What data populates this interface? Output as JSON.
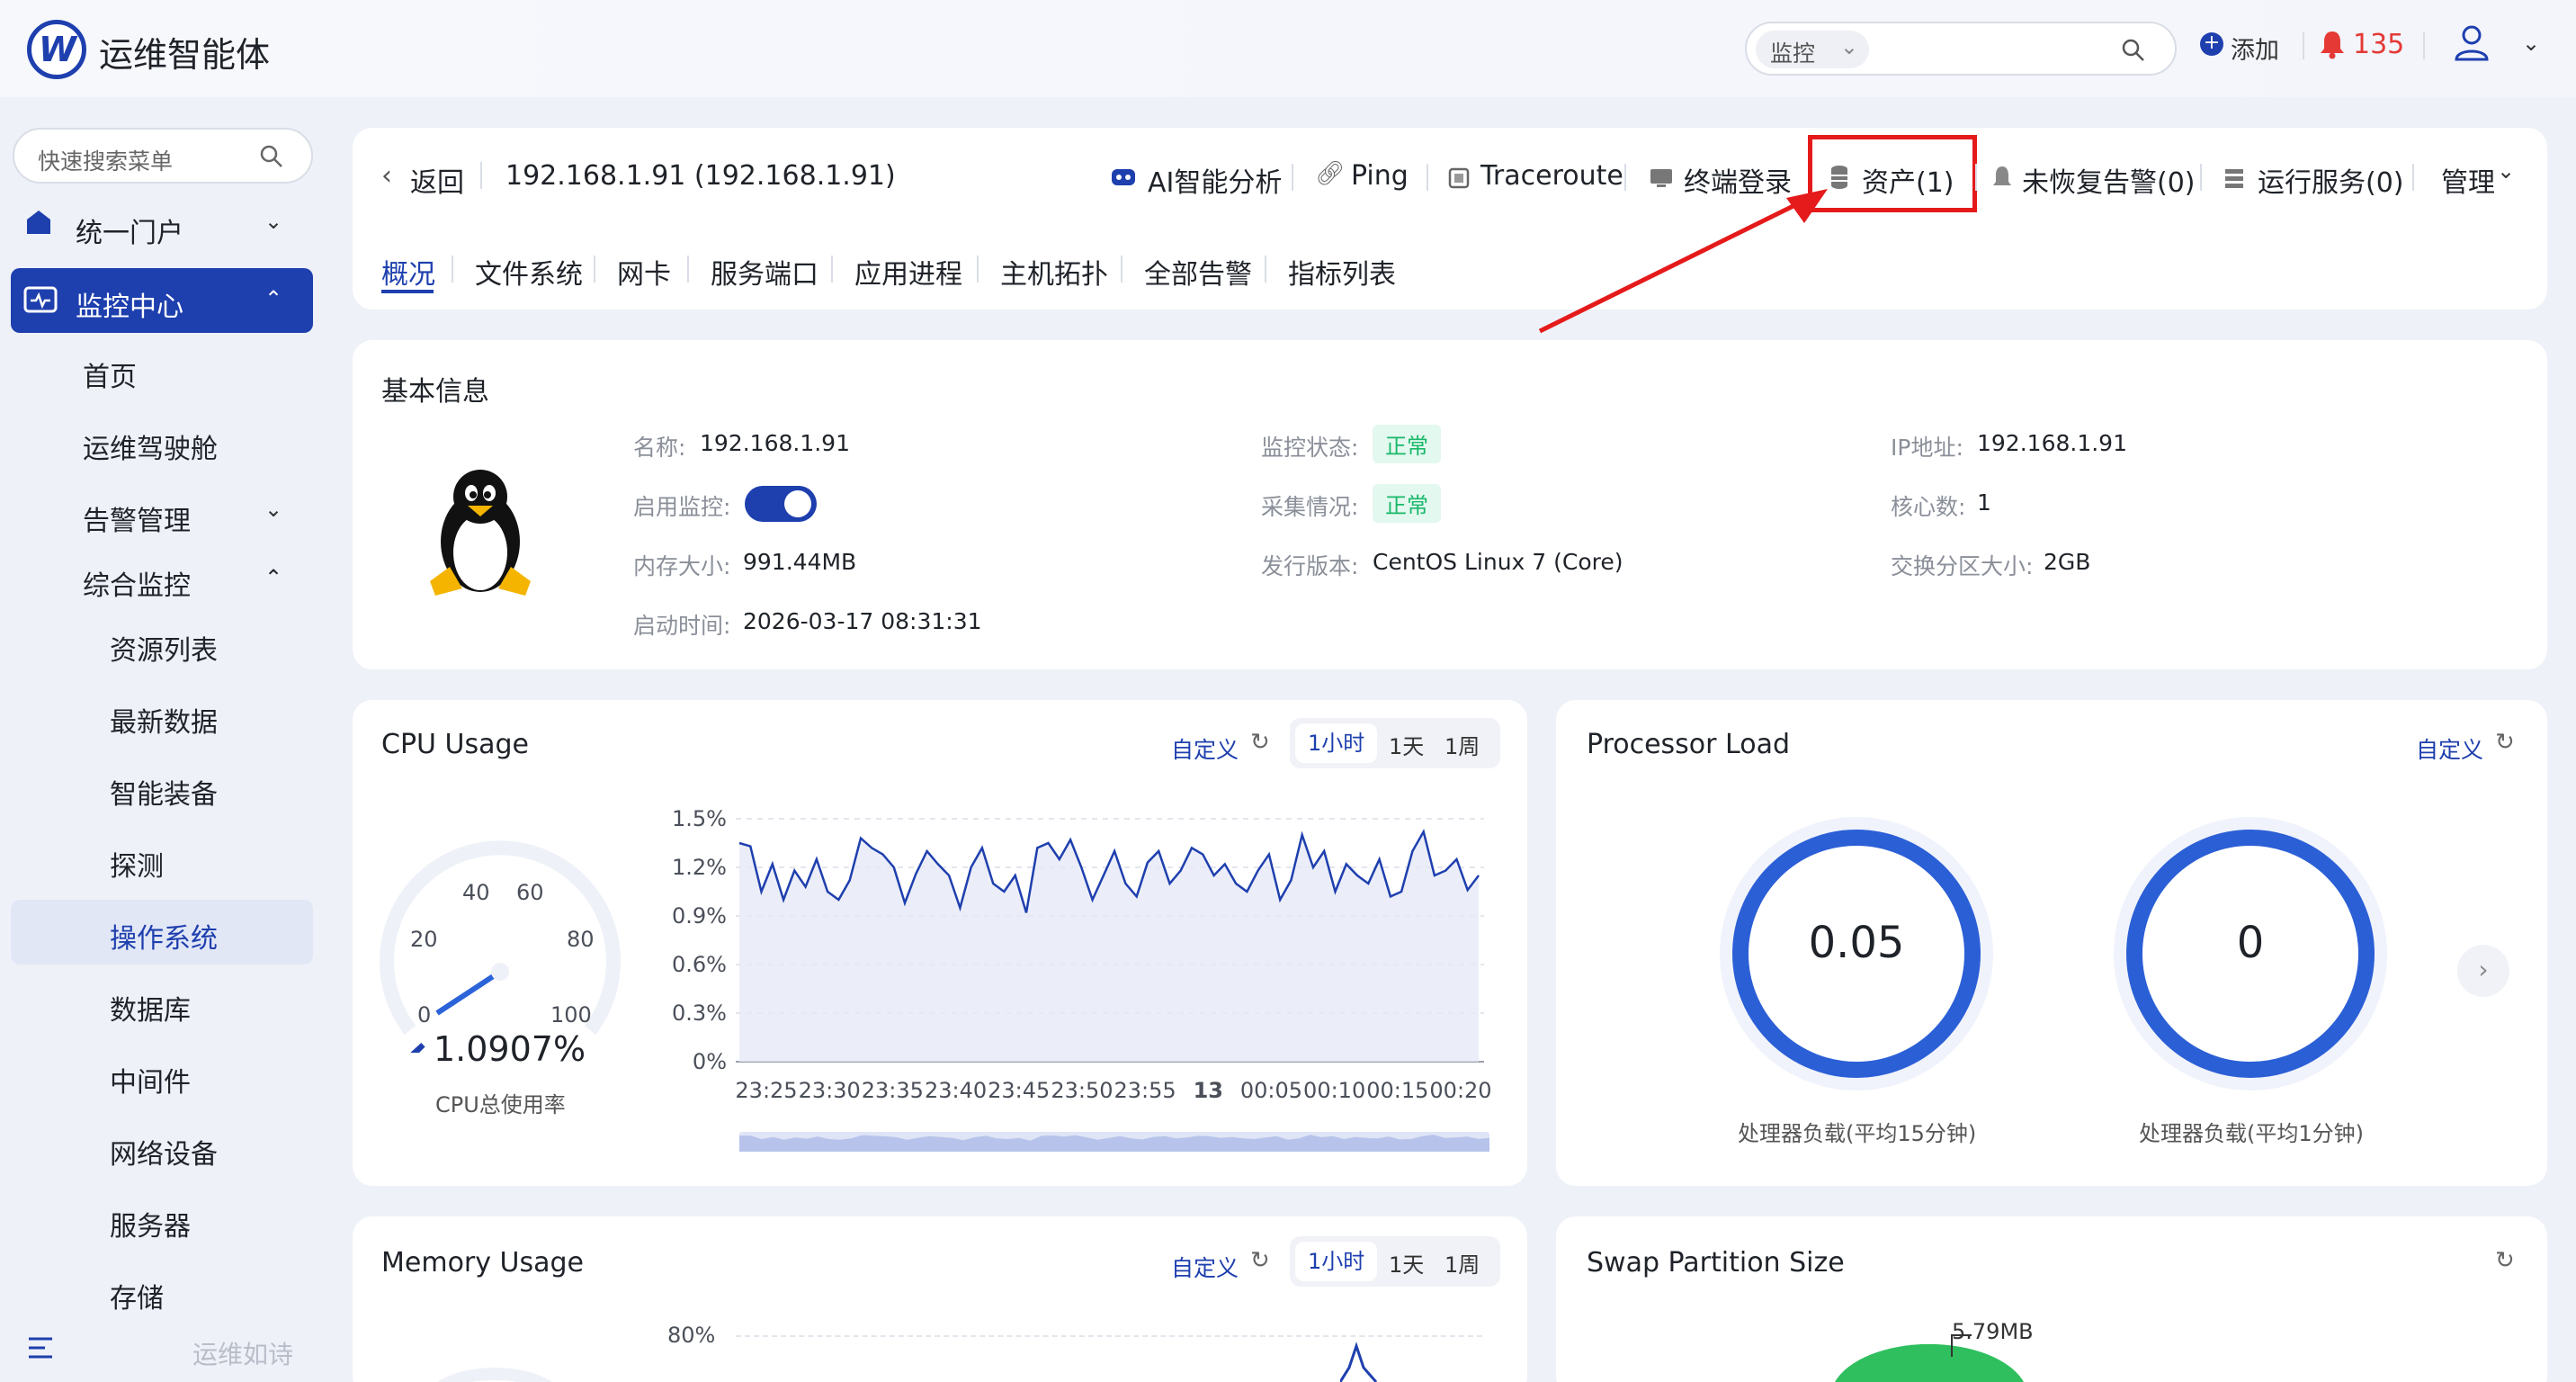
{
  "app": {
    "title": "运维智能体"
  },
  "header": {
    "search_scope": "监控",
    "add_label": "添加",
    "alert_count": "135"
  },
  "sidebar": {
    "search_placeholder": "快速搜索菜单",
    "portal": "统一门户",
    "monitor_center": "监控中心",
    "items": [
      "首页",
      "运维驾驶舱",
      "告警管理",
      "综合监控"
    ],
    "sub_items": [
      "资源列表",
      "最新数据",
      "智能装备",
      "探测",
      "操作系统",
      "数据库",
      "中间件",
      "网络设备",
      "服务器",
      "存储"
    ],
    "footer": "运维如诗"
  },
  "toolbar": {
    "back": "返回",
    "host": "192.168.1.91 (192.168.1.91)",
    "ai": "AI智能分析",
    "ping": "Ping",
    "traceroute": "Traceroute",
    "terminal": "终端登录",
    "assets": "资产(1)",
    "alerts": "未恢复告警(0)",
    "services": "运行服务(0)",
    "manage": "管理"
  },
  "tabs": [
    "概况",
    "文件系统",
    "网卡",
    "服务端口",
    "应用进程",
    "主机拓扑",
    "全部告警",
    "指标列表"
  ],
  "basic_info": {
    "title": "基本信息",
    "name_label": "名称:",
    "name": "192.168.1.91",
    "enable_label": "启用监控:",
    "mem_label": "内存大小:",
    "mem": "991.44MB",
    "boot_label": "启动时间:",
    "boot": "2026-03-17 08:31:31",
    "status_label": "监控状态:",
    "status": "正常",
    "collect_label": "采集情况:",
    "collect": "正常",
    "release_label": "发行版本:",
    "release": "CentOS Linux 7 (Core)",
    "ip_label": "IP地址:",
    "ip": "192.168.1.91",
    "cores_label": "核心数:",
    "cores": "1",
    "swap_label": "交换分区大小:",
    "swap": "2GB"
  },
  "cpu": {
    "title": "CPU Usage",
    "custom": "自定义",
    "ranges": [
      "1小时",
      "1天",
      "1周"
    ],
    "gauge_value": "1.0907%",
    "gauge_label": "CPU总使用率",
    "gauge_level": 1.0907,
    "gauge_ticks": [
      "0",
      "20",
      "40",
      "60",
      "80",
      "100"
    ]
  },
  "processor": {
    "title": "Processor Load",
    "custom": "自定义",
    "load15": "0.05",
    "load15_label": "处理器负载(平均15分钟)",
    "load1": "0",
    "load1_label": "处理器负载(平均1分钟)"
  },
  "memory": {
    "title": "Memory Usage",
    "custom": "自定义",
    "ranges": [
      "1小时",
      "1天",
      "1周"
    ],
    "y_top": "80%"
  },
  "swap": {
    "title": "Swap Partition Size",
    "value": "5.79MB"
  },
  "chart_data": {
    "type": "area",
    "title": "CPU Usage",
    "y_ticks": [
      "1.5%",
      "1.2%",
      "0.9%",
      "0.6%",
      "0.3%",
      "0%"
    ],
    "ylim": [
      0,
      1.5
    ],
    "x_ticks": [
      "23:25",
      "23:30",
      "23:35",
      "23:40",
      "23:45",
      "23:50",
      "23:55",
      "13",
      "00:05",
      "00:10",
      "00:15",
      "00:20"
    ],
    "values": [
      1.35,
      1.33,
      1.05,
      1.22,
      1.0,
      1.18,
      1.08,
      1.25,
      1.05,
      1.0,
      1.12,
      1.38,
      1.32,
      1.28,
      1.2,
      0.98,
      1.16,
      1.3,
      1.22,
      1.15,
      0.95,
      1.2,
      1.32,
      1.1,
      1.05,
      1.15,
      0.92,
      1.32,
      1.35,
      1.25,
      1.37,
      1.2,
      1.0,
      1.15,
      1.3,
      1.1,
      1.02,
      1.23,
      1.3,
      1.1,
      1.18,
      1.32,
      1.28,
      1.15,
      1.22,
      1.1,
      1.05,
      1.18,
      1.28,
      1.0,
      1.12,
      1.4,
      1.2,
      1.3,
      1.05,
      1.22,
      1.15,
      1.1,
      1.25,
      1.02,
      1.05,
      1.3,
      1.42,
      1.15,
      1.18,
      1.25,
      1.06,
      1.15
    ],
    "grid": true
  }
}
